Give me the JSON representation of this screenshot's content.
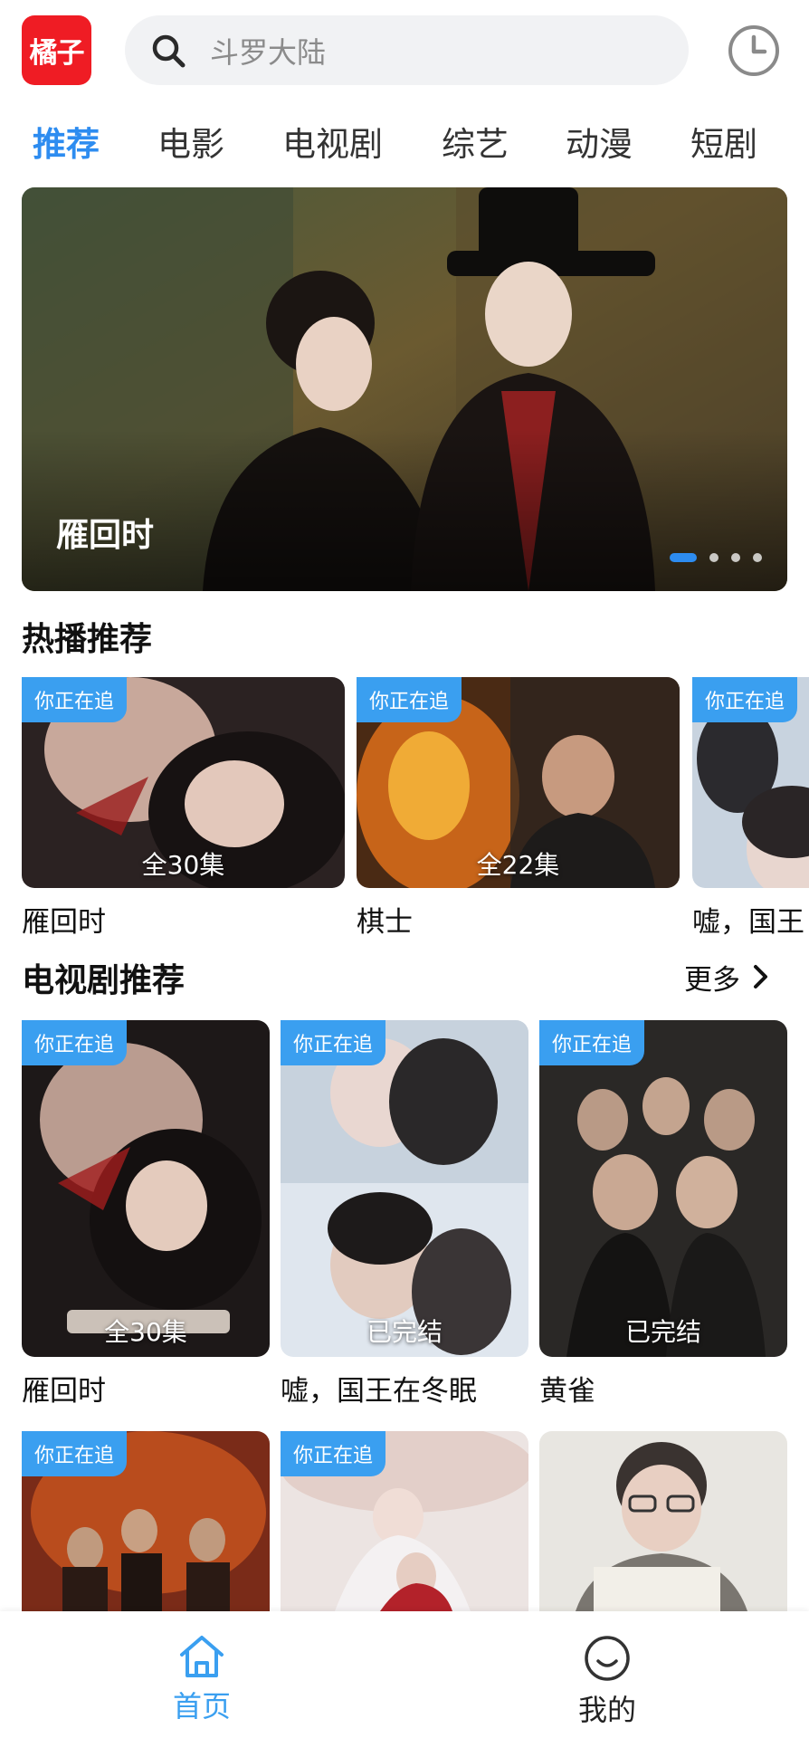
{
  "header": {
    "logo_text": "橘子",
    "search_placeholder": "斗罗大陆"
  },
  "tabs": [
    {
      "label": "推荐",
      "active": true
    },
    {
      "label": "电影",
      "active": false
    },
    {
      "label": "电视剧",
      "active": false
    },
    {
      "label": "综艺",
      "active": false
    },
    {
      "label": "动漫",
      "active": false
    },
    {
      "label": "短剧",
      "active": false
    }
  ],
  "banner": {
    "title": "雁回时",
    "page_count": 4,
    "active_index": 0
  },
  "hot_section": {
    "title": "热播推荐",
    "items": [
      {
        "badge": "你正在追",
        "episodes": "全30集",
        "title": "雁回时"
      },
      {
        "badge": "你正在追",
        "episodes": "全22集",
        "title": "棋士"
      },
      {
        "badge": "你正在追",
        "episodes": "",
        "title": "嘘，国王"
      }
    ]
  },
  "tv_section": {
    "title": "电视剧推荐",
    "more_label": "更多",
    "items": [
      {
        "badge": "你正在追",
        "episodes": "全30集",
        "title": "雁回时"
      },
      {
        "badge": "你正在追",
        "episodes": "已完结",
        "title": "嘘，国王在冬眠"
      },
      {
        "badge": "你正在追",
        "episodes": "已完结",
        "title": "黄雀"
      },
      {
        "badge": "你正在追",
        "episodes": "",
        "title": ""
      },
      {
        "badge": "你正在追",
        "episodes": "",
        "title": ""
      },
      {
        "badge": "",
        "episodes": "",
        "title": ""
      }
    ]
  },
  "bottom_nav": {
    "home_label": "首页",
    "mine_label": "我的"
  },
  "colors": {
    "accent": "#2d8cf0",
    "logo_red": "#ef1c24",
    "badge_blue": "#3a9ff0"
  },
  "icons": [
    "search-icon",
    "clock-icon",
    "home-icon",
    "smiley-icon",
    "chevron-right-icon"
  ]
}
